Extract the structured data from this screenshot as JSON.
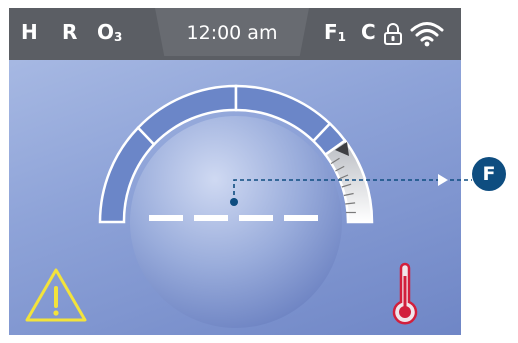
{
  "status_bar": {
    "heater_indicator": "H",
    "recirc_indicator": "R",
    "ozone_indicator": {
      "letter": "O",
      "sub": "3"
    },
    "time": "12:00 am",
    "filter_indicator": {
      "letter": "F",
      "sub": "1"
    },
    "clean_indicator": "C",
    "lock_icon": "lock-icon",
    "wifi_icon": "wifi-icon"
  },
  "main": {
    "temperature_readout": "- - - -",
    "temperature_level": 0.9,
    "warning_icon": "warning-icon",
    "thermometer_icon": "thermometer-icon"
  },
  "callout": {
    "label": "F"
  },
  "colors": {
    "status_bar": "#5b5e64",
    "screen_bg": "#8ea3d8",
    "arc_segment": "#6b86c8",
    "warning": "#f3e33b",
    "thermometer": "#d21f3c",
    "callout": "#0e4d80"
  }
}
